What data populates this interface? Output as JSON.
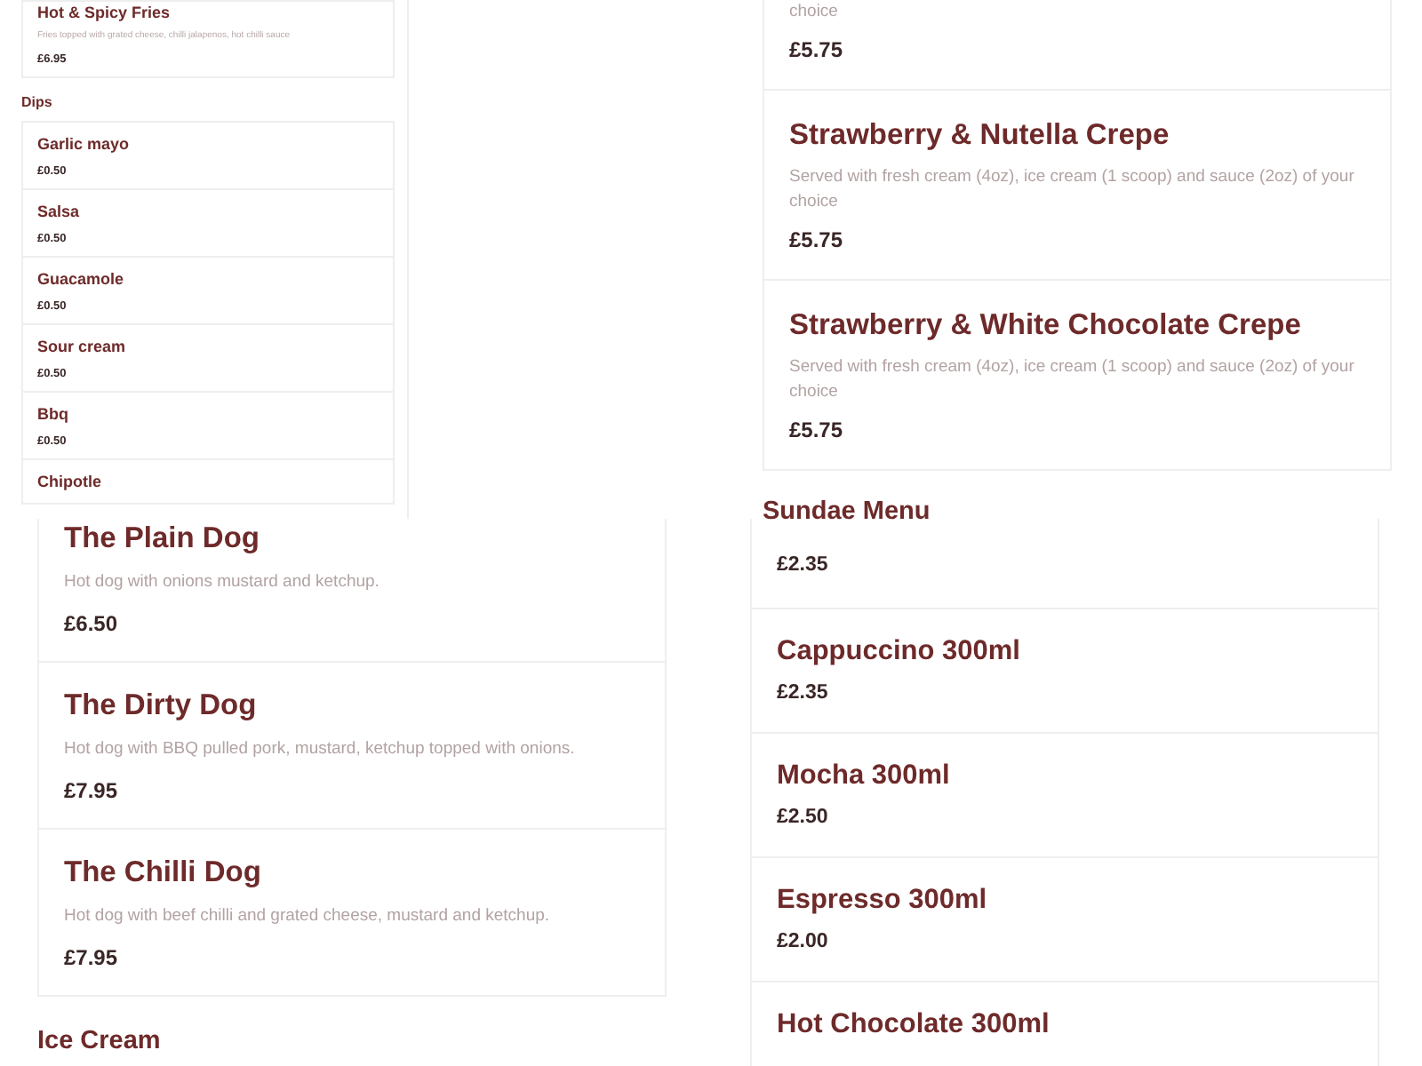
{
  "side_panel": {
    "top_item": {
      "name": "Hot & Spicy Fries",
      "description": "Fries topped with grated cheese, chilli jalapenos, hot chilli sauce",
      "price": "£6.95"
    },
    "dips_heading": "Dips",
    "dips": [
      {
        "name": "Garlic mayo",
        "price": "£0.50"
      },
      {
        "name": "Salsa",
        "price": "£0.50"
      },
      {
        "name": "Guacamole",
        "price": "£0.50"
      },
      {
        "name": "Sour cream",
        "price": "£0.50"
      },
      {
        "name": "Bbq",
        "price": "£0.50"
      },
      {
        "name": "Chipotle"
      }
    ]
  },
  "crepes": [
    {
      "description": "choice",
      "price": "£5.75"
    },
    {
      "name": "Strawberry & Nutella Crepe",
      "description": "Served with fresh cream (4oz), ice cream (1 scoop) and sauce (2oz) of your choice",
      "price": "£5.75"
    },
    {
      "name": "Strawberry & White Chocolate Crepe",
      "description": "Served with fresh cream (4oz), ice cream (1 scoop) and sauce (2oz) of your choice",
      "price": "£5.75"
    }
  ],
  "sundae_heading": "Sundae Menu",
  "hot_dogs": [
    {
      "name": "The Plain Dog",
      "description": "Hot dog with onions mustard and ketchup.",
      "price": "£6.50"
    },
    {
      "name": "The Dirty Dog",
      "description": "Hot dog with BBQ pulled pork, mustard, ketchup topped with onions.",
      "price": "£7.95"
    },
    {
      "name": "The Chilli Dog",
      "description": "Hot dog with beef chilli and grated cheese, mustard and ketchup.",
      "price": "£7.95"
    }
  ],
  "ice_cream_heading": "Ice Cream",
  "drinks": [
    {
      "price": "£2.35"
    },
    {
      "name": "Cappuccino 300ml",
      "price": "£2.35"
    },
    {
      "name": "Mocha 300ml",
      "price": "£2.50"
    },
    {
      "name": "Espresso 300ml",
      "price": "£2.00"
    },
    {
      "name": "Hot Chocolate 300ml"
    }
  ]
}
